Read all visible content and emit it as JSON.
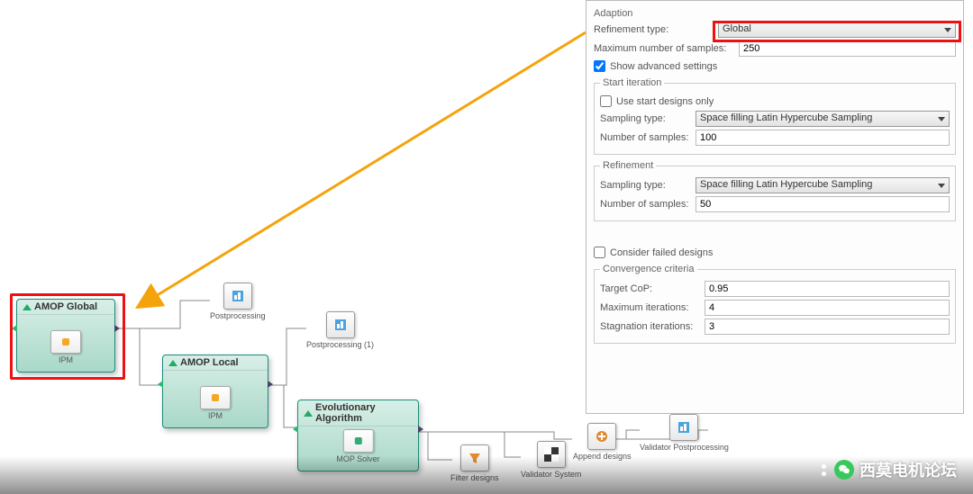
{
  "workflow": {
    "amop_global": {
      "title": "AMOP Global",
      "inner": "IPM"
    },
    "amop_local": {
      "title": "AMOP Local",
      "inner": "IPM"
    },
    "ea": {
      "title": "Evolutionary Algorithm",
      "inner": "MOP Solver"
    },
    "post": "Postprocessing",
    "post1": "Postprocessing (1)",
    "filter": "Filter designs",
    "validator_system": "Validator System",
    "append": "Append designs",
    "validator_post": "Validator Postprocessing"
  },
  "panel": {
    "adaption": {
      "label": "Adaption",
      "refinement_type_label": "Refinement type:",
      "refinement_type_value": "Global",
      "max_samples_label": "Maximum number of samples:",
      "max_samples_value": "250"
    },
    "show_advanced": {
      "label": "Show advanced settings",
      "checked": true
    },
    "start_iteration": {
      "legend": "Start iteration",
      "use_start_only": {
        "label": "Use start designs only",
        "checked": false
      },
      "sampling_type_label": "Sampling type:",
      "sampling_type_value": "Space filling Latin Hypercube Sampling",
      "num_samples_label": "Number of samples:",
      "num_samples_value": "100"
    },
    "refinement": {
      "legend": "Refinement",
      "sampling_type_label": "Sampling type:",
      "sampling_type_value": "Space filling Latin Hypercube Sampling",
      "num_samples_label": "Number of samples:",
      "num_samples_value": "50"
    },
    "consider_failed": {
      "label": "Consider failed designs",
      "checked": false
    },
    "convergence": {
      "legend": "Convergence criteria",
      "target_cop_label": "Target CoP:",
      "target_cop_value": "0.95",
      "max_iter_label": "Maximum iterations:",
      "max_iter_value": "4",
      "stag_iter_label": "Stagnation iterations:",
      "stag_iter_value": "3"
    }
  },
  "watermark": "西莫电机论坛"
}
